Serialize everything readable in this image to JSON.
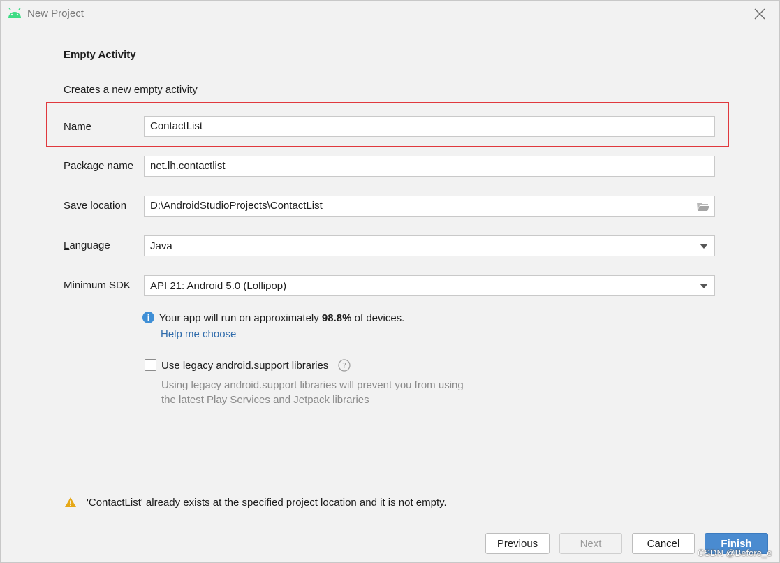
{
  "window": {
    "title": "New Project",
    "close_icon": "close-icon",
    "app_icon": "android-icon"
  },
  "page": {
    "heading": "Empty Activity",
    "subheading": "Creates a new empty activity"
  },
  "fields": {
    "name": {
      "label_mnemonic": "N",
      "label_rest": "ame",
      "value": "ContactList"
    },
    "package": {
      "label_mnemonic": "P",
      "label_rest": "ackage name",
      "value": "net.lh.contactlist"
    },
    "save_location": {
      "label_mnemonic": "S",
      "label_rest": "ave location",
      "value": "D:\\AndroidStudioProjects\\ContactList",
      "icon": "folder-icon"
    },
    "language": {
      "label_mnemonic": "L",
      "label_rest": "anguage",
      "value": "Java"
    },
    "min_sdk": {
      "label": "Minimum SDK",
      "value": "API 21: Android 5.0 (Lollipop)"
    }
  },
  "info": {
    "prefix": "Your app will run on approximately ",
    "percent": "98.8%",
    "suffix": " of devices.",
    "help_link": "Help me choose"
  },
  "legacy": {
    "checked": false,
    "label": "Use legacy android.support libraries",
    "note_line1": "Using legacy android.support libraries will prevent you from using",
    "note_line2": "the latest Play Services and Jetpack libraries"
  },
  "warning": "'ContactList' already exists at the specified project location and it is not empty.",
  "buttons": {
    "previous": {
      "mnemonic": "P",
      "rest": "revious"
    },
    "next": "Next",
    "cancel": {
      "mnemonic": "C",
      "rest": "ancel"
    },
    "finish": "Finish"
  },
  "colors": {
    "highlight_border": "#e0393e",
    "primary_button": "#4a8bd0",
    "link": "#2f6bab",
    "info_icon": "#3f8fd6",
    "warning_icon": "#e6a817",
    "android_green": "#3ddc84"
  },
  "watermark": "CSDN @Before_e"
}
